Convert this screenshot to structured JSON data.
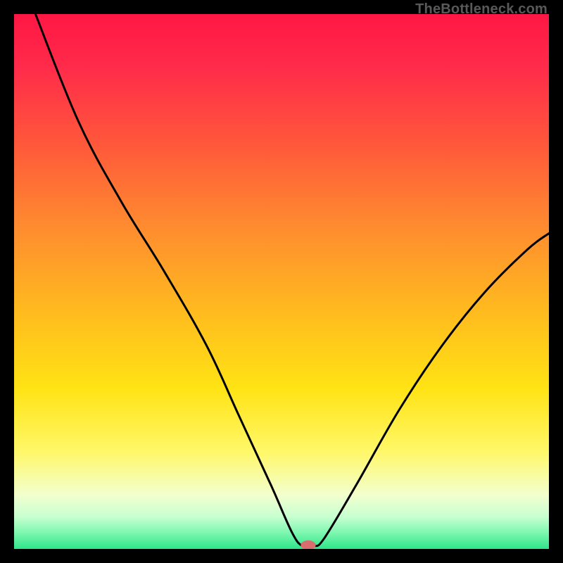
{
  "watermark": "TheBottleneck.com",
  "colors": {
    "frame_bg": "#000000",
    "curve_stroke": "#000000",
    "marker_fill": "#d96c6c",
    "gradient_stops": [
      {
        "offset": 0.0,
        "color": "#ff1744"
      },
      {
        "offset": 0.1,
        "color": "#ff2b4a"
      },
      {
        "offset": 0.25,
        "color": "#ff5a3a"
      },
      {
        "offset": 0.4,
        "color": "#ff8c2f"
      },
      {
        "offset": 0.55,
        "color": "#ffb91f"
      },
      {
        "offset": 0.7,
        "color": "#ffe314"
      },
      {
        "offset": 0.82,
        "color": "#fff86a"
      },
      {
        "offset": 0.9,
        "color": "#f2ffcf"
      },
      {
        "offset": 0.94,
        "color": "#c7ffd0"
      },
      {
        "offset": 0.97,
        "color": "#7cf7b0"
      },
      {
        "offset": 1.0,
        "color": "#2ee58a"
      }
    ]
  },
  "chart_data": {
    "type": "line",
    "title": "",
    "xlabel": "",
    "ylabel": "",
    "xlim": [
      0,
      100
    ],
    "ylim": [
      0,
      100
    ],
    "series": [
      {
        "name": "bottleneck-curve",
        "points": [
          {
            "x": 4,
            "y": 100
          },
          {
            "x": 12,
            "y": 80
          },
          {
            "x": 20,
            "y": 65
          },
          {
            "x": 28,
            "y": 52
          },
          {
            "x": 36,
            "y": 38
          },
          {
            "x": 42,
            "y": 25
          },
          {
            "x": 48,
            "y": 12
          },
          {
            "x": 52,
            "y": 3
          },
          {
            "x": 54,
            "y": 0.5
          },
          {
            "x": 56,
            "y": 0.5
          },
          {
            "x": 58,
            "y": 2
          },
          {
            "x": 64,
            "y": 12
          },
          {
            "x": 72,
            "y": 26
          },
          {
            "x": 80,
            "y": 38
          },
          {
            "x": 88,
            "y": 48
          },
          {
            "x": 96,
            "y": 56
          },
          {
            "x": 100,
            "y": 59
          }
        ]
      }
    ],
    "marker": {
      "x": 55,
      "y": 0.7,
      "rx": 1.4,
      "ry": 0.9
    }
  }
}
